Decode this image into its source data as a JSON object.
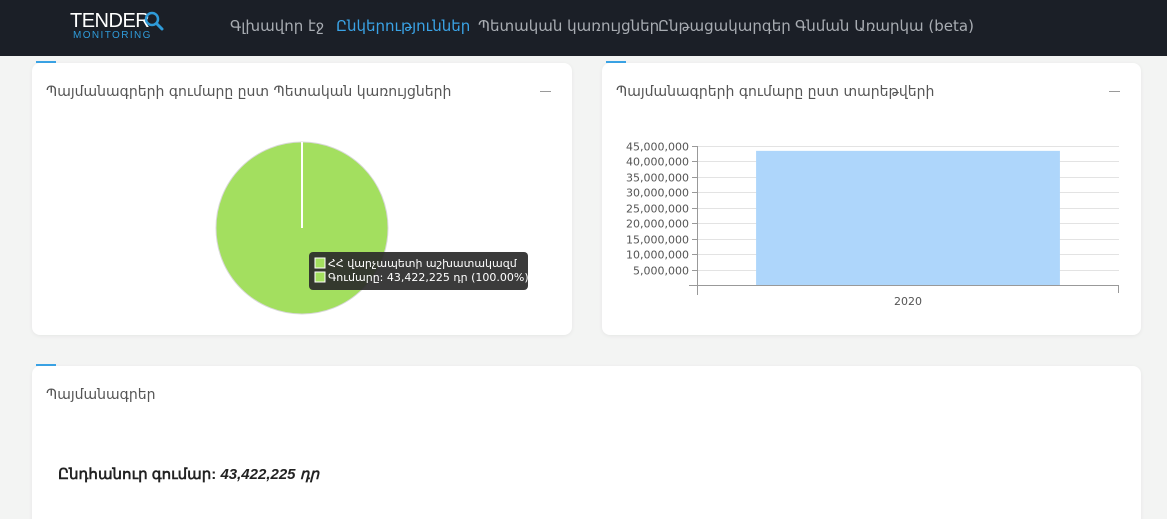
{
  "nav": {
    "logo_main": "TENDER",
    "logo_sub": "MONITORING",
    "items": [
      {
        "label": "Գլխավոր էջ",
        "active": false
      },
      {
        "label": "Ընկերություններ",
        "active": true
      },
      {
        "label": "Պետական կառույցներ",
        "active": false
      },
      {
        "label": "Ընթացակարգեր",
        "active": false
      },
      {
        "label": "Գնման Առարկա (beta)",
        "active": false
      }
    ]
  },
  "colors": {
    "accent": "#3aa3e6",
    "pie": "#a3df5f",
    "bar": "#aed6fb",
    "navbar": "#1b1f27"
  },
  "pie_card": {
    "title": "Պայմանագրերի գումարը ըստ Պետական կառույցների",
    "tooltip": {
      "line1": "ՀՀ վարչապետի աշխատակազմ",
      "line2": "Գումարը: 43,422,225 դր (100.00%)"
    }
  },
  "bar_card": {
    "title": "Պայմանագրերի գումարը ըստ տարեթվերի"
  },
  "chart_data": [
    {
      "type": "pie",
      "categories": [
        "ՀՀ վարչապետի աշխատակազմ"
      ],
      "values": [
        43422225
      ],
      "percentages": [
        100.0
      ]
    },
    {
      "type": "bar",
      "categories": [
        "2020"
      ],
      "values": [
        43422225
      ],
      "ylim": [
        0,
        45000000
      ],
      "yticks": [
        "5,000,000",
        "10,000,000",
        "15,000,000",
        "20,000,000",
        "25,000,000",
        "30,000,000",
        "35,000,000",
        "40,000,000",
        "45,000,000"
      ],
      "ytick_values": [
        5000000,
        10000000,
        15000000,
        20000000,
        25000000,
        30000000,
        35000000,
        40000000,
        45000000
      ],
      "grid": true
    }
  ],
  "contracts_card": {
    "title": "Պայմանագրեր",
    "total_label": "Ընդհանուր գումար:",
    "total_value": "43,422,225 դր"
  }
}
